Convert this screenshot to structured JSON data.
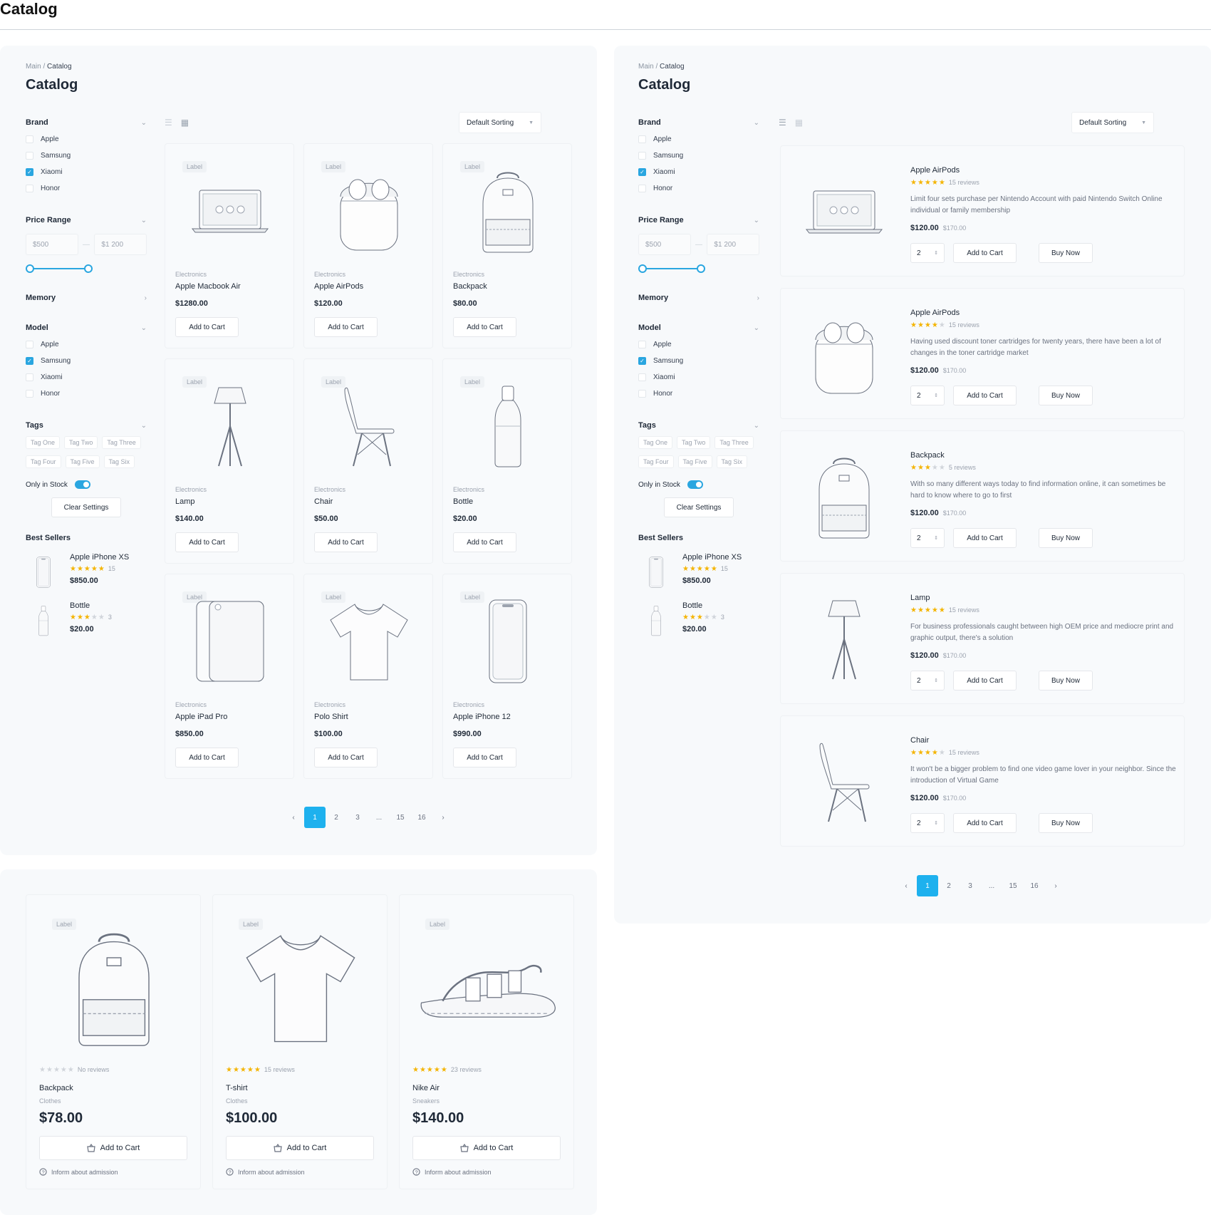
{
  "page_title": "Catalog",
  "breadcrumb": {
    "main": "Main",
    "sep": "/",
    "current": "Catalog"
  },
  "catalog_title": "Catalog",
  "filters": {
    "brand": {
      "title": "Brand",
      "items": [
        {
          "label": "Apple",
          "checked": false
        },
        {
          "label": "Samsung",
          "checked": false
        },
        {
          "label": "Xiaomi",
          "checked": true
        },
        {
          "label": "Honor",
          "checked": false
        }
      ]
    },
    "price": {
      "title": "Price Range",
      "min": "$500",
      "max": "$1 200",
      "dash": "—"
    },
    "memory": {
      "title": "Memory"
    },
    "model": {
      "title": "Model",
      "items": [
        {
          "label": "Apple",
          "checked": false
        },
        {
          "label": "Samsung",
          "checked": true
        },
        {
          "label": "Xiaomi",
          "checked": false
        },
        {
          "label": "Honor",
          "checked": false
        }
      ]
    },
    "tags": {
      "title": "Tags",
      "items": [
        "Tag One",
        "Tag Two",
        "Tag Three",
        "Tag Four",
        "Tag Five",
        "Tag Six"
      ]
    },
    "stock_label": "Only in Stock",
    "clear_label": "Clear Settings"
  },
  "best_sellers": {
    "title": "Best Sellers",
    "items": [
      {
        "name": "Apple iPhone XS",
        "rating": 5,
        "count": "15",
        "price": "$850.00",
        "icon": "phone-icon"
      },
      {
        "name": "Bottle",
        "rating": 3,
        "count": "3",
        "price": "$20.00",
        "icon": "bottle-icon"
      }
    ]
  },
  "sort_label": "Default Sorting",
  "grid_products": [
    {
      "label": "Label",
      "category": "Electronics",
      "name": "Apple Macbook Air",
      "price": "$1280.00",
      "button": "Add to Cart",
      "icon": "laptop-icon"
    },
    {
      "label": "Label",
      "category": "Electronics",
      "name": "Apple AirPods",
      "price": "$120.00",
      "button": "Add to Cart",
      "icon": "airpods-icon"
    },
    {
      "label": "Label",
      "category": "Electronics",
      "name": "Backpack",
      "price": "$80.00",
      "button": "Add to Cart",
      "icon": "backpack-icon"
    },
    {
      "label": "Label",
      "category": "Electronics",
      "name": "Lamp",
      "price": "$140.00",
      "button": "Add to Cart",
      "icon": "lamp-icon"
    },
    {
      "label": "Label",
      "category": "Electronics",
      "name": "Chair",
      "price": "$50.00",
      "button": "Add to Cart",
      "icon": "chair-icon"
    },
    {
      "label": "Label",
      "category": "Electronics",
      "name": "Bottle",
      "price": "$20.00",
      "button": "Add to Cart",
      "icon": "bottle-icon"
    },
    {
      "label": "Label",
      "category": "Electronics",
      "name": "Apple iPad Pro",
      "price": "$850.00",
      "button": "Add to Cart",
      "icon": "tablet-icon"
    },
    {
      "label": "Label",
      "category": "Electronics",
      "name": "Polo Shirt",
      "price": "$100.00",
      "button": "Add to Cart",
      "icon": "shirt-icon"
    },
    {
      "label": "Label",
      "category": "Electronics",
      "name": "Apple iPhone 12",
      "price": "$990.00",
      "button": "Add to Cart",
      "icon": "phone-icon"
    }
  ],
  "pagination": {
    "prev": "‹",
    "pages": [
      "1",
      "2",
      "3",
      "...",
      "15",
      "16"
    ],
    "next": "›",
    "current": "1"
  },
  "list_products": [
    {
      "name": "Apple AirPods",
      "rating": 5,
      "reviews": "15 reviews",
      "desc": "Limit four sets purchase per Nintendo Account with paid Nintendo Switch Online individual or family membership",
      "price": "$120.00",
      "old_price": "$170.00",
      "qty": "2",
      "add": "Add to Cart",
      "buy": "Buy Now",
      "icon": "laptop-icon"
    },
    {
      "name": "Apple AirPods",
      "rating": 4,
      "reviews": "15 reviews",
      "desc": "Having used discount toner cartridges for twenty years, there have been a lot of changes in the toner cartridge market",
      "price": "$120.00",
      "old_price": "$170.00",
      "qty": "2",
      "add": "Add to Cart",
      "buy": "Buy Now",
      "icon": "airpods-icon"
    },
    {
      "name": "Backpack",
      "rating": 3,
      "reviews": "5 reviews",
      "desc": "With so many different ways today to find information online, it can sometimes be hard to know where to go to first",
      "price": "$120.00",
      "old_price": "$170.00",
      "qty": "2",
      "add": "Add to Cart",
      "buy": "Buy Now",
      "icon": "backpack-icon"
    },
    {
      "name": "Lamp",
      "rating": 5,
      "reviews": "15 reviews",
      "desc": "For business professionals caught between high OEM price and mediocre print and graphic output, there's a solution",
      "price": "$120.00",
      "old_price": "$170.00",
      "qty": "2",
      "add": "Add to Cart",
      "buy": "Buy Now",
      "icon": "lamp-icon"
    },
    {
      "name": "Chair",
      "rating": 4,
      "reviews": "15 reviews",
      "desc": "It won't be a bigger problem to find one video game lover in your neighbor. Since the introduction of Virtual Game",
      "price": "$120.00",
      "old_price": "$170.00",
      "qty": "2",
      "add": "Add to Cart",
      "buy": "Buy Now",
      "icon": "chair-icon"
    }
  ],
  "big_products": [
    {
      "label": "Label",
      "rating": 0,
      "reviews": "No reviews",
      "name": "Backpack",
      "category": "Clothes",
      "price": "$78.00",
      "button": "Add to Cart",
      "info": "Inform about admission",
      "icon": "backpack-icon"
    },
    {
      "label": "Label",
      "rating": 5,
      "reviews": "15 reviews",
      "name": "T-shirt",
      "category": "Clothes",
      "price": "$100.00",
      "button": "Add to Cart",
      "info": "Inform about admission",
      "icon": "shirt-icon"
    },
    {
      "label": "Label",
      "rating": 5,
      "reviews": "23 reviews",
      "name": "Nike Air",
      "category": "Sneakers",
      "price": "$140.00",
      "button": "Add to Cart",
      "info": "Inform about admission",
      "icon": "sandal-icon"
    }
  ],
  "colors": {
    "accent": "#1eb1ee",
    "star": "#f4b400",
    "panel": "#f7f9fb"
  }
}
